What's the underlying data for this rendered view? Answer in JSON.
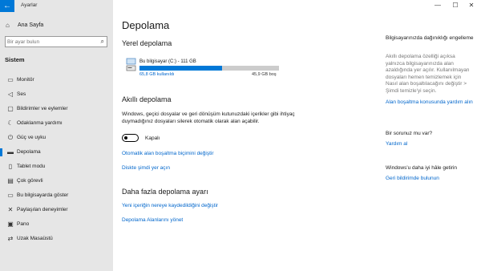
{
  "app": {
    "title": "Ayarlar",
    "back_icon": "back-arrow-icon"
  },
  "sidebar": {
    "home_label": "Ana Sayfa",
    "search_placeholder": "Bir ayar bulun",
    "section": "Sistem",
    "items": [
      {
        "label": "Monitör",
        "icon": "monitor-icon"
      },
      {
        "label": "Ses",
        "icon": "speaker-icon"
      },
      {
        "label": "Bildirimler ve eylemler",
        "icon": "notification-icon"
      },
      {
        "label": "Odaklanma yardımı",
        "icon": "moon-icon"
      },
      {
        "label": "Güç ve uyku",
        "icon": "power-icon"
      },
      {
        "label": "Depolama",
        "icon": "storage-icon",
        "active": true
      },
      {
        "label": "Tablet modu",
        "icon": "tablet-icon"
      },
      {
        "label": "Çok görevli",
        "icon": "multitask-icon"
      },
      {
        "label": "Bu bilgisayarda göster",
        "icon": "project-icon"
      },
      {
        "label": "Paylaşılan deneyimler",
        "icon": "share-icon"
      },
      {
        "label": "Pano",
        "icon": "clipboard-icon"
      },
      {
        "label": "Uzak Masaüstü",
        "icon": "remote-desktop-icon"
      }
    ]
  },
  "main": {
    "title": "Depolama",
    "local_storage_heading": "Yerel depolama",
    "drive": {
      "name": "Bu bilgisayar (C:) - 111 GB",
      "used": "65,8 GB kullanıldı",
      "free": "45,9 GB boş",
      "used_fraction": 0.593
    },
    "smart_heading": "Akıllı depolama",
    "smart_description": "Windows, geçici dosyalar ve geri dönüşüm kutunuzdaki içerikler gibi ihtiyaç duymadığınız dosyaları silerek otomatik olarak alan açabilir.",
    "toggle_label": "Kapalı",
    "toggle_on": false,
    "link_configure": "Otomatik alan boşaltma biçimini değiştir",
    "link_free_now": "Diskte şimdi yer açın",
    "more_heading": "Daha fazla depolama ayarı",
    "link_save_location": "Yeni içeriğin nereye kaydedildiğini değiştir",
    "link_spaces": "Depolama Alanlarını yönet"
  },
  "aside": {
    "tip_heading": "Bilgisayarınızda dağınıklığı engelleme",
    "tip_body": "Akıllı depolama özelliği açıksa yalnızca bilgisayarınızda alan azaldığında yer açılır. Kullanılmayan dosyaları hemen temizlemek için Nasıl alan boşaltılacağını değiştir > Şimdi temizle'yi seçin.",
    "tip_link": "Alan boşaltma konusunda yardım alın",
    "question_heading": "Bir sorunuz mu var?",
    "question_link": "Yardım al",
    "improve_heading": "Windows'u daha iyi hâle getirin",
    "improve_link": "Geri bildirimde bulunun"
  },
  "window_controls": {
    "minimize": "—",
    "maximize": "☐",
    "close": "✕"
  }
}
